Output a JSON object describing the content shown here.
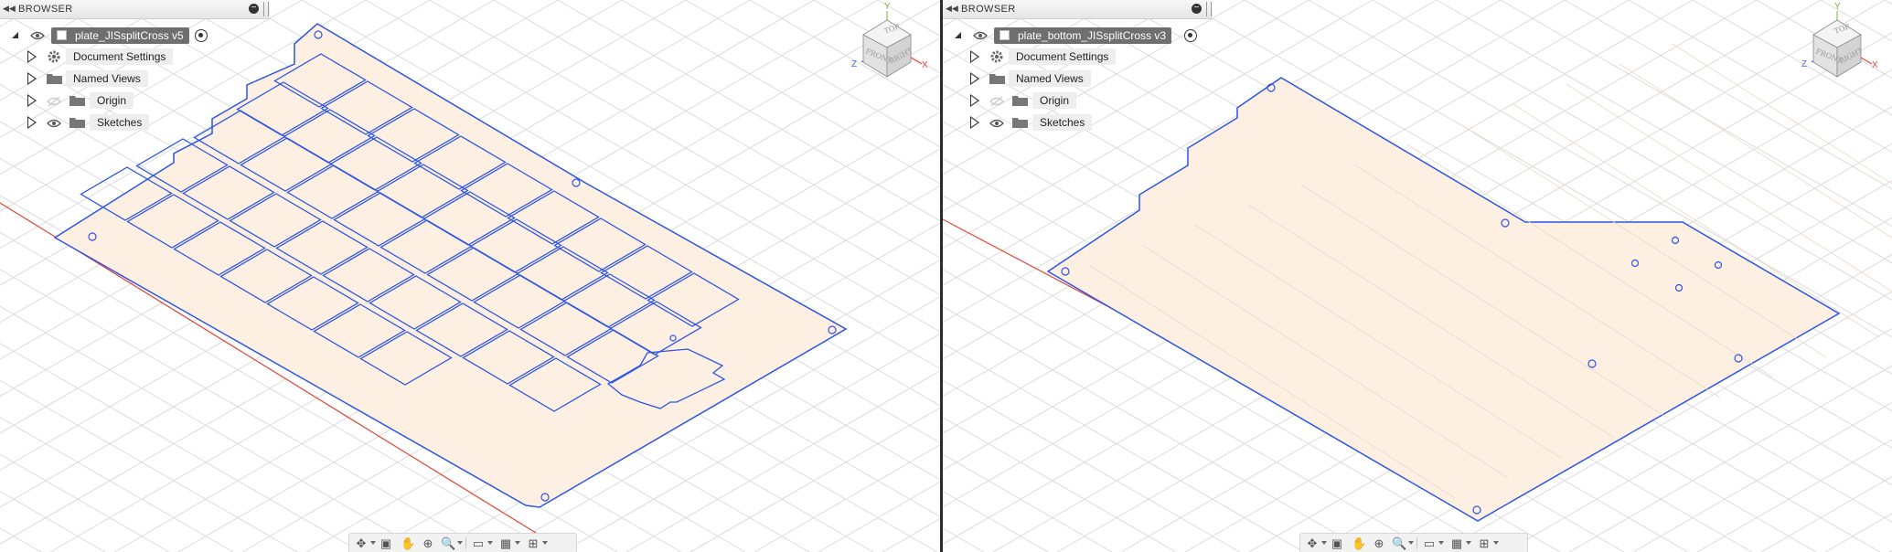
{
  "left": {
    "browser": {
      "title": "BROWSER",
      "component": "plate_JISsplitCross v5",
      "items": [
        {
          "label": "Document Settings",
          "icon": "gear-icon"
        },
        {
          "label": "Named Views",
          "icon": "folder-icon"
        },
        {
          "label": "Origin",
          "icon": "folder-icon",
          "visible": false
        },
        {
          "label": "Sketches",
          "icon": "folder-icon",
          "visible": true
        }
      ]
    },
    "viewcube": {
      "top": "TOP",
      "front": "FRONT",
      "right": "RIGHT",
      "axis_x": "X",
      "axis_y": "Y",
      "axis_z": "Z"
    }
  },
  "right": {
    "browser": {
      "title": "BROWSER",
      "component": "plate_bottom_JISsplitCross v3",
      "items": [
        {
          "label": "Document Settings",
          "icon": "gear-icon"
        },
        {
          "label": "Named Views",
          "icon": "folder-icon"
        },
        {
          "label": "Origin",
          "icon": "folder-icon",
          "visible": false
        },
        {
          "label": "Sketches",
          "icon": "folder-icon",
          "visible": true
        }
      ]
    },
    "viewcube": {
      "top": "TOP",
      "front": "FRONT",
      "right": "RIGHT",
      "axis_x": "X",
      "axis_y": "Y",
      "axis_z": "Z"
    }
  },
  "navbar_tools": [
    "orbit-icon",
    "look-at-icon",
    "pan-icon",
    "zoom-icon",
    "fit-icon",
    "display-settings-icon",
    "grid-settings-icon",
    "viewports-icon"
  ],
  "colors": {
    "edge": "#2c54e8",
    "face": "#fdf0e3",
    "grid": "#d9d9d9",
    "x_axis": "#e0483b",
    "divider": "#2b2b2b"
  }
}
